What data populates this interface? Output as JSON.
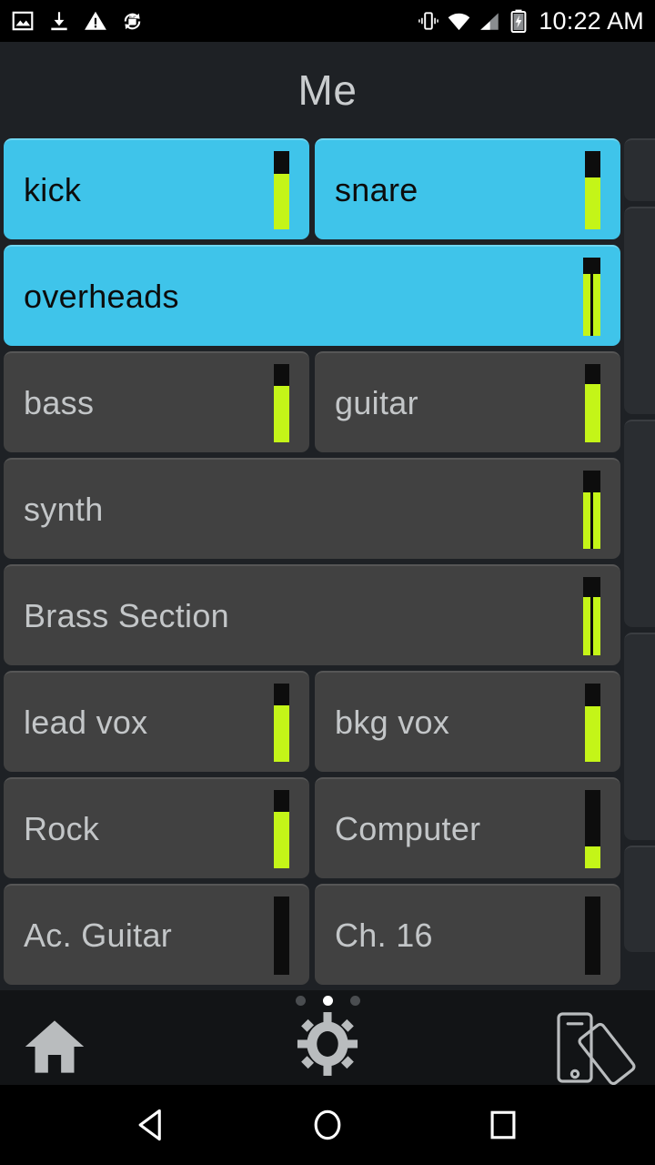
{
  "status_bar": {
    "time": "10:22 AM",
    "left_icons": [
      "image-icon",
      "download-icon",
      "warning-icon",
      "android-sync-icon"
    ],
    "right_icons": [
      "vibrate-icon",
      "wifi-icon",
      "signal-icon",
      "battery-charging-icon"
    ]
  },
  "header": {
    "title": "Me"
  },
  "colors": {
    "background": "#1e2125",
    "strip_inactive": "#414141",
    "strip_selected": "#3fc4ea",
    "meter_green": "#c4f518",
    "meter_track": "#0d0d0d",
    "label_inactive": "#c3c6c8",
    "label_selected": "#0c0c0c",
    "title": "#c9ccce",
    "toolbar": "#121416",
    "dot_active": "#ffffff",
    "dot_inactive": "#4a4d50"
  },
  "mixer": {
    "rows": [
      {
        "strips": [
          {
            "label": "kick",
            "selected": true,
            "stereo": false,
            "level": 70,
            "wide": false
          },
          {
            "label": "snare",
            "selected": true,
            "stereo": false,
            "level": 66,
            "wide": false
          }
        ]
      },
      {
        "strips": [
          {
            "label": "overheads",
            "selected": true,
            "stereo": true,
            "level": 78,
            "wide": true
          }
        ]
      },
      {
        "strips": [
          {
            "label": "bass",
            "selected": false,
            "stereo": false,
            "level": 72,
            "wide": false
          },
          {
            "label": "guitar",
            "selected": false,
            "stereo": false,
            "level": 74,
            "wide": false
          }
        ]
      },
      {
        "strips": [
          {
            "label": "synth",
            "selected": false,
            "stereo": true,
            "level": 72,
            "wide": true
          }
        ]
      },
      {
        "strips": [
          {
            "label": "Brass Section",
            "selected": false,
            "stereo": true,
            "level": 74,
            "wide": true
          }
        ]
      },
      {
        "strips": [
          {
            "label": "lead vox",
            "selected": false,
            "stereo": false,
            "level": 72,
            "wide": false
          },
          {
            "label": "bkg vox",
            "selected": false,
            "stereo": false,
            "level": 70,
            "wide": false
          }
        ]
      },
      {
        "strips": [
          {
            "label": "Rock",
            "selected": false,
            "stereo": false,
            "level": 72,
            "wide": false
          },
          {
            "label": "Computer",
            "selected": false,
            "stereo": false,
            "level": 27,
            "wide": false
          }
        ]
      },
      {
        "strips": [
          {
            "label": "Ac. Guitar",
            "selected": false,
            "stereo": false,
            "level": 0,
            "wide": false
          },
          {
            "label": "Ch. 16",
            "selected": false,
            "stereo": false,
            "level": 0,
            "wide": false
          }
        ]
      }
    ],
    "peek_strip_heights": [
      69,
      228,
      228,
      228,
      117
    ]
  },
  "toolbar": {
    "page_dots": {
      "count": 3,
      "active_index": 1
    },
    "home_label": "Home",
    "settings_label": "Settings",
    "rotate_label": "Device Layout"
  },
  "nav_bar": {
    "back_label": "Back",
    "home_label": "Home",
    "recents_label": "Recents"
  }
}
